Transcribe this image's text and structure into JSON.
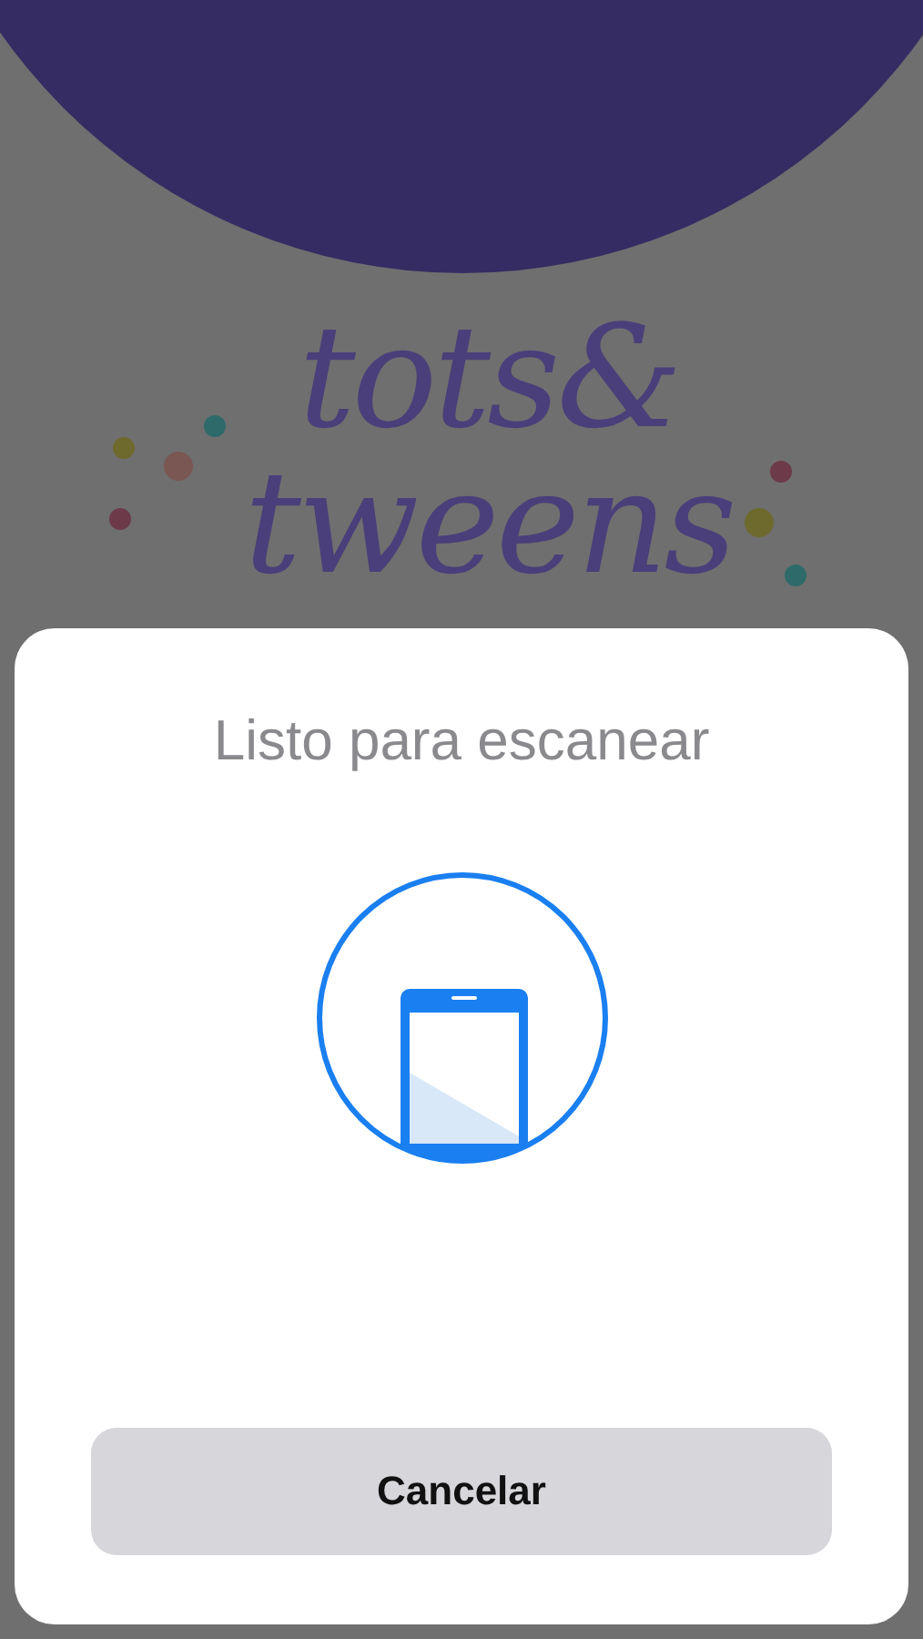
{
  "background": {
    "logo_lines": [
      "tots&",
      "tweens"
    ]
  },
  "sheet": {
    "title": "Listo para escanear",
    "button": "Cancelar"
  }
}
